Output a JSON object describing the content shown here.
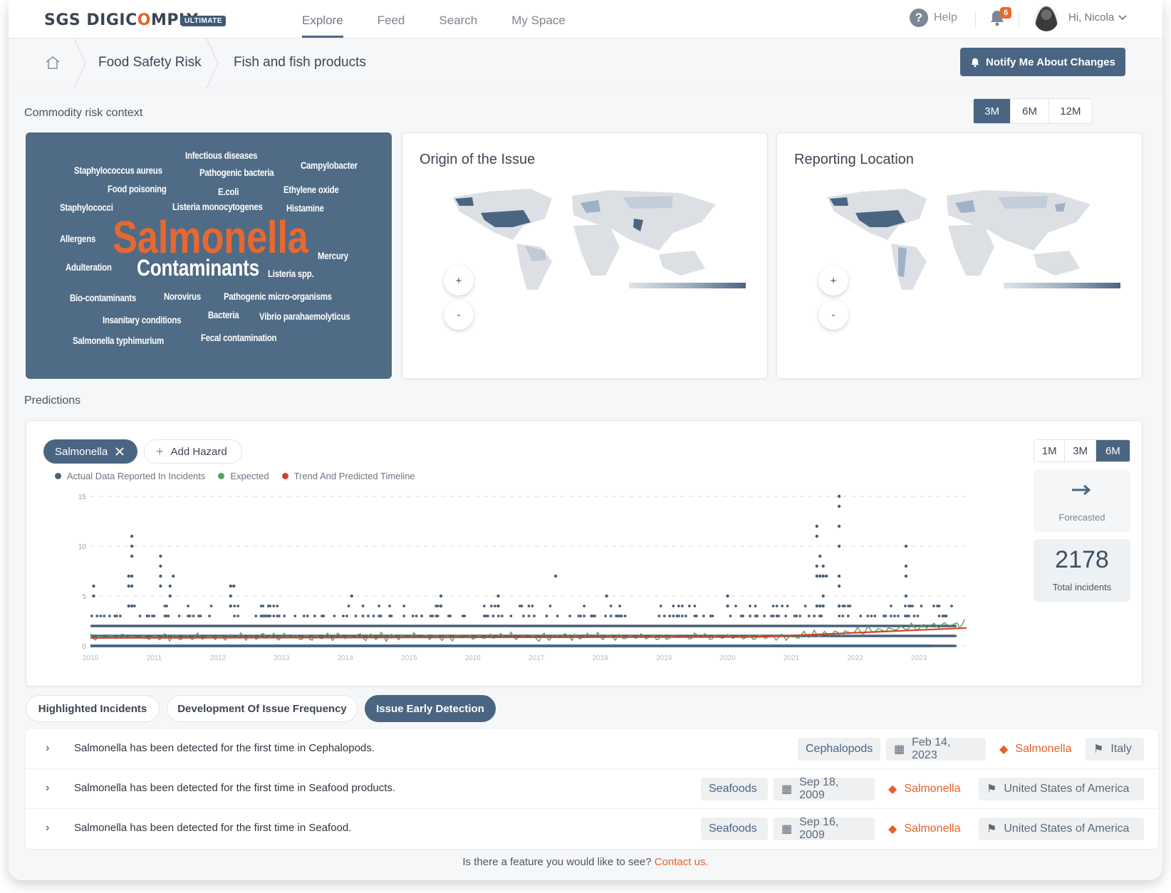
{
  "brand": {
    "logo_pre": "SGS DIGIC",
    "logo_o": "O",
    "logo_post": "MPLY",
    "tier": "ULTIMATE"
  },
  "nav": {
    "items": [
      "Explore",
      "Feed",
      "Search",
      "My Space"
    ],
    "active": "Explore"
  },
  "header": {
    "help_label": "Help",
    "notification_count": "6",
    "greeting": "Hi, Nicola"
  },
  "breadcrumb": {
    "items": [
      "Food Safety Risk",
      "Fish and fish products"
    ]
  },
  "notify_button": "Notify Me About Changes",
  "context": {
    "title": "Commodity risk context",
    "periods": [
      "3M",
      "6M",
      "12M"
    ],
    "active_period": "3M",
    "wordcloud": [
      "Infectious diseases",
      "Staphylococcus aureus",
      "Pathogenic bacteria",
      "Campylobacter",
      "Food poisoning",
      "E.coli",
      "Ethylene oxide",
      "Staphylococci",
      "Listeria monocytogenes",
      "Histamine",
      "Allergens",
      "Salmonella",
      "Mercury",
      "Adulteration",
      "Contaminants",
      "Listeria spp.",
      "Bio-contaminants",
      "Norovirus",
      "Pathogenic micro-organisms",
      "Insanitary conditions",
      "Bacteria",
      "Vibrio parahaemolyticus",
      "Salmonella typhimurium",
      "Fecal contamination"
    ],
    "origin_title": "Origin of the Issue",
    "reporting_title": "Reporting Location",
    "zoom_in": "+",
    "zoom_out": "-",
    "highlight_color": "#4a6582"
  },
  "predictions": {
    "title": "Predictions",
    "selected_hazard": "Salmonella",
    "add_hazard": "Add Hazard",
    "legend": [
      {
        "label": "Actual Data Reported In Incidents",
        "color": "#4a5f74"
      },
      {
        "label": "Expected",
        "color": "#5aa05a"
      },
      {
        "label": "Trend And Predicted Timeline",
        "color": "#d6402a"
      }
    ],
    "range_buttons": [
      "1M",
      "3M",
      "6M"
    ],
    "active_range": "6M",
    "forecast_label": "Forecasted",
    "forecast_icon": "arrow-right-icon",
    "total_incidents": "2178",
    "total_label": "Total incidents"
  },
  "chart_data": {
    "type": "scatter",
    "x_ticks": [
      "2010",
      "2011",
      "2012",
      "2013",
      "2014",
      "2015",
      "2016",
      "2017",
      "2018",
      "2019",
      "2020",
      "2021",
      "2022",
      "2023"
    ],
    "y_ticks": [
      "0",
      "5",
      "10",
      "15"
    ],
    "ylim": [
      0,
      15
    ],
    "xlim": [
      2010,
      2023.75
    ],
    "peaks": [
      [
        2010.05,
        6
      ],
      [
        2010.65,
        11
      ],
      [
        2010.6,
        7
      ],
      [
        2011.1,
        9
      ],
      [
        2011.3,
        7
      ],
      [
        2011.25,
        6
      ],
      [
        2012.2,
        6
      ],
      [
        2012.25,
        6
      ],
      [
        2014.1,
        5
      ],
      [
        2015.5,
        5
      ],
      [
        2016.4,
        5
      ],
      [
        2017.3,
        7
      ],
      [
        2018.1,
        5
      ],
      [
        2020.0,
        5
      ],
      [
        2021.4,
        12
      ],
      [
        2021.45,
        9
      ],
      [
        2021.5,
        8
      ],
      [
        2021.75,
        15
      ],
      [
        2022.8,
        10
      ],
      [
        2021.55,
        7
      ]
    ],
    "series": [
      {
        "name": "Actual Data Reported In Incidents",
        "marker": "dot"
      },
      {
        "name": "Expected",
        "marker": "line"
      },
      {
        "name": "Trend And Predicted Timeline",
        "marker": "line"
      }
    ]
  },
  "tabs": {
    "items": [
      "Highlighted Incidents",
      "Development Of Issue Frequency",
      "Issue Early Detection"
    ],
    "active": "Issue Early Detection"
  },
  "incidents": [
    {
      "text": "Salmonella has been detected for the first time in Cephalopods.",
      "category": "Cephalopods",
      "date": "Feb 14, 2023",
      "hazard": "Salmonella",
      "country": "Italy"
    },
    {
      "text": "Salmonella has been detected for the first time in Seafood products.",
      "category": "Seafoods",
      "date": "Sep 18, 2009",
      "hazard": "Salmonella",
      "country": "United States of America"
    },
    {
      "text": "Salmonella has been detected for the first time in Seafood.",
      "category": "Seafoods",
      "date": "Sep 16, 2009",
      "hazard": "Salmonella",
      "country": "United States of America"
    }
  ],
  "footer": {
    "question": "Is there a feature you would like to see?",
    "link": "Contact us."
  }
}
